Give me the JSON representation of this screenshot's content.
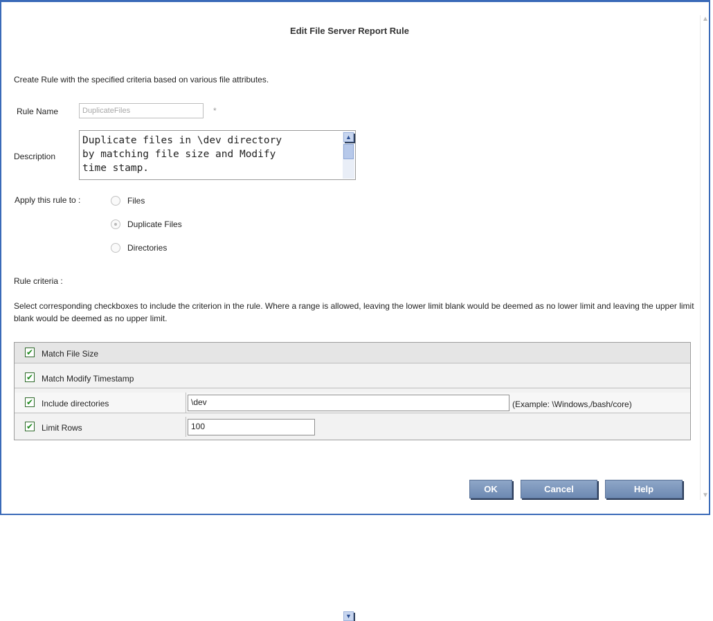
{
  "dialog": {
    "title": "Edit File Server Report Rule",
    "intro": "Create Rule with the specified criteria based on various file attributes."
  },
  "rule_name": {
    "label": "Rule Name",
    "value": "DuplicateFiles",
    "required_marker": "*"
  },
  "description": {
    "label": "Description",
    "value": "Duplicate files in \\dev directory\nby matching file size and Modify\ntime stamp."
  },
  "apply_to": {
    "label": "Apply this rule to :",
    "options": [
      {
        "label": "Files",
        "selected": false
      },
      {
        "label": "Duplicate Files",
        "selected": true
      },
      {
        "label": "Directories",
        "selected": false
      }
    ]
  },
  "criteria": {
    "heading": "Rule criteria :",
    "help_text": "Select corresponding checkboxes to include the criterion in the rule. Where a range is allowed, leaving the lower limit blank would be deemed as no lower limit and leaving the upper limit blank would be deemed as no upper limit.",
    "rows": [
      {
        "label": "Match File Size",
        "checked": true
      },
      {
        "label": "Match Modify Timestamp",
        "checked": true
      },
      {
        "label": "Include directories",
        "checked": true,
        "value": "\\dev",
        "example": "(Example: \\Windows,/bash/core)"
      },
      {
        "label": "Limit Rows",
        "checked": true,
        "value": "100"
      }
    ]
  },
  "buttons": {
    "ok": "OK",
    "cancel": "Cancel",
    "help": "Help"
  },
  "icons": {
    "checkmark": "✔",
    "scroll_up": "▲",
    "scroll_down": "▼"
  },
  "colors": {
    "frame_border": "#3a6ab8",
    "button_bg": "#7f98bd",
    "check_color": "#1d8a1d"
  }
}
